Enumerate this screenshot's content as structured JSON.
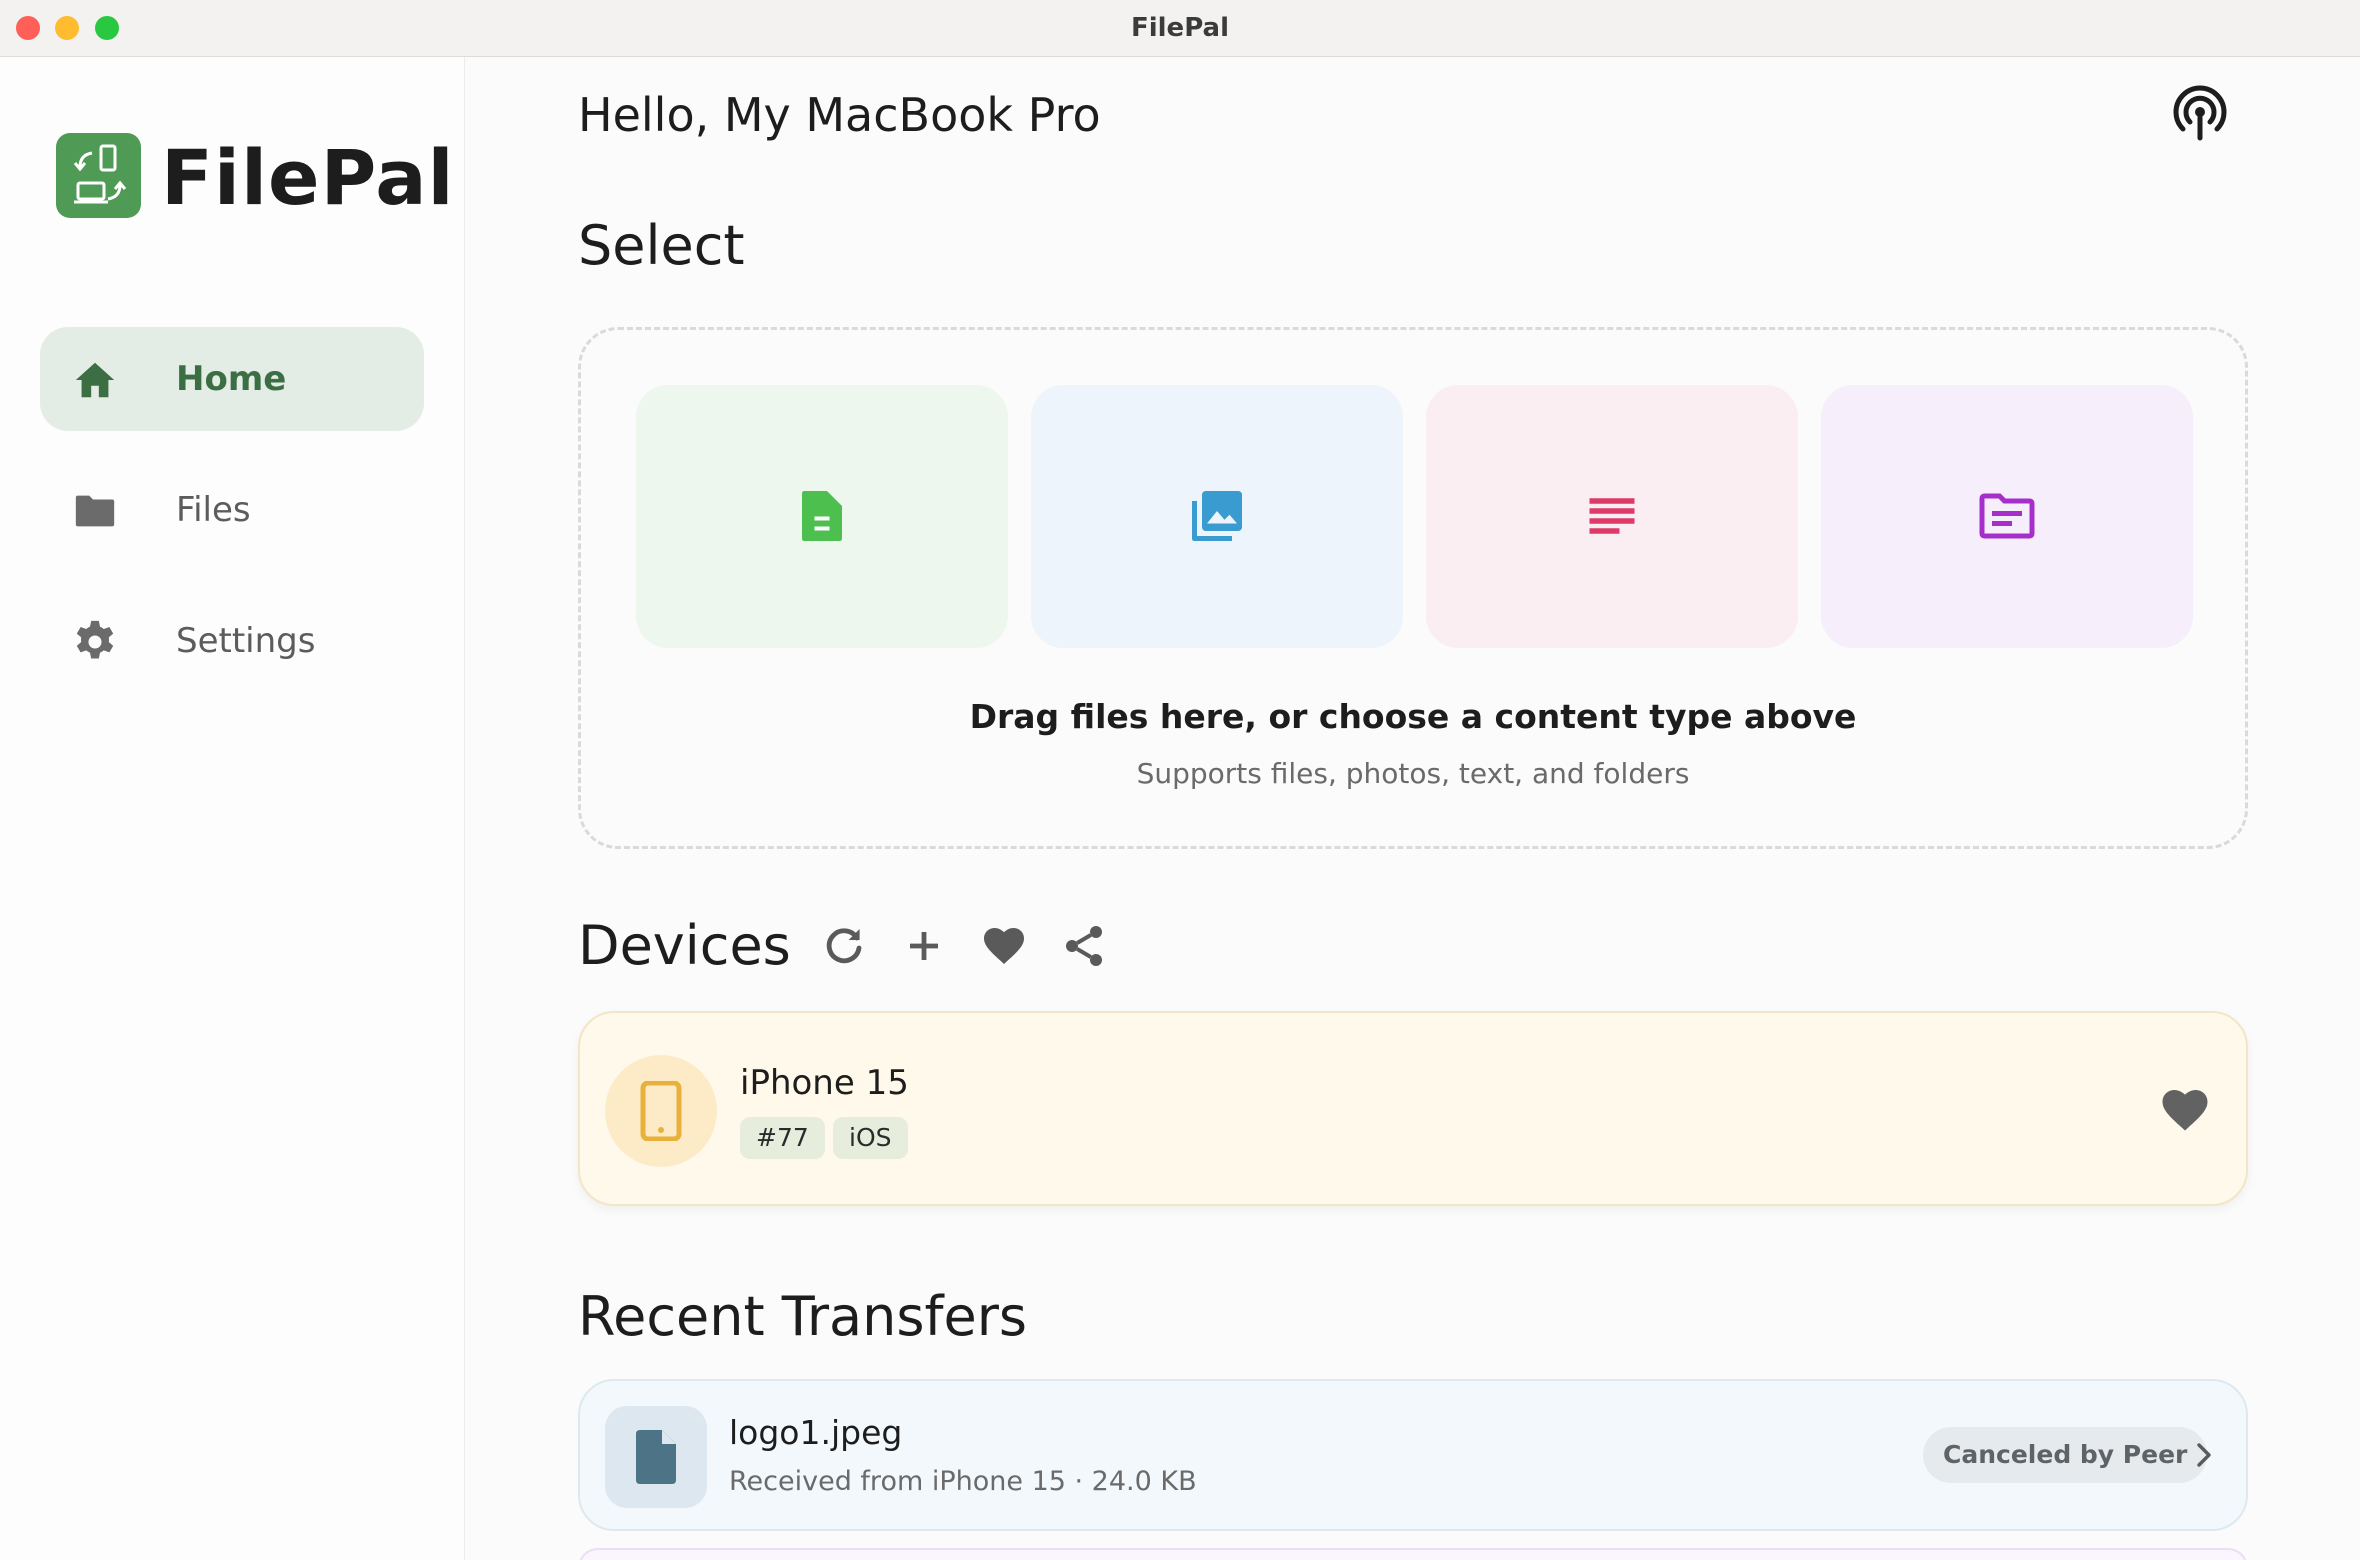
{
  "window": {
    "title": "FilePal"
  },
  "sidebar": {
    "app_name": "FilePal",
    "items": [
      {
        "label": "Home",
        "icon": "home-icon",
        "active": true
      },
      {
        "label": "Files",
        "icon": "folder-icon",
        "active": false
      },
      {
        "label": "Settings",
        "icon": "gear-icon",
        "active": false
      }
    ]
  },
  "header": {
    "greeting": "Hello, My MacBook Pro",
    "action_icon": "broadcast-icon"
  },
  "select": {
    "title": "Select",
    "tiles": [
      {
        "icon": "file-icon",
        "color": "#4cbf4f",
        "bg": "#eef7ee"
      },
      {
        "icon": "photos-icon",
        "color": "#3a9bd0",
        "bg": "#edf4fb"
      },
      {
        "icon": "text-icon",
        "color": "#dd3a6a",
        "bg": "#fbeef3"
      },
      {
        "icon": "folder-icon",
        "color": "#a52fc8",
        "bg": "#f7eefb"
      }
    ],
    "drop_title": "Drag files here, or choose a content type above",
    "drop_subtitle": "Supports files, photos, text, and folders"
  },
  "devices": {
    "title": "Devices",
    "tools": [
      "refresh-icon",
      "add-icon",
      "heart-icon",
      "share-icon"
    ],
    "list": [
      {
        "name": "iPhone 15",
        "tags": [
          "#77",
          "iOS"
        ],
        "icon": "phone-icon",
        "accent": "#e8b13b"
      }
    ]
  },
  "recent": {
    "title": "Recent Transfers",
    "items": [
      {
        "file_name": "logo1.jpeg",
        "meta": "Received from iPhone 15 · 24.0 KB",
        "status": "Canceled by Peer",
        "icon": "document-icon"
      }
    ]
  }
}
